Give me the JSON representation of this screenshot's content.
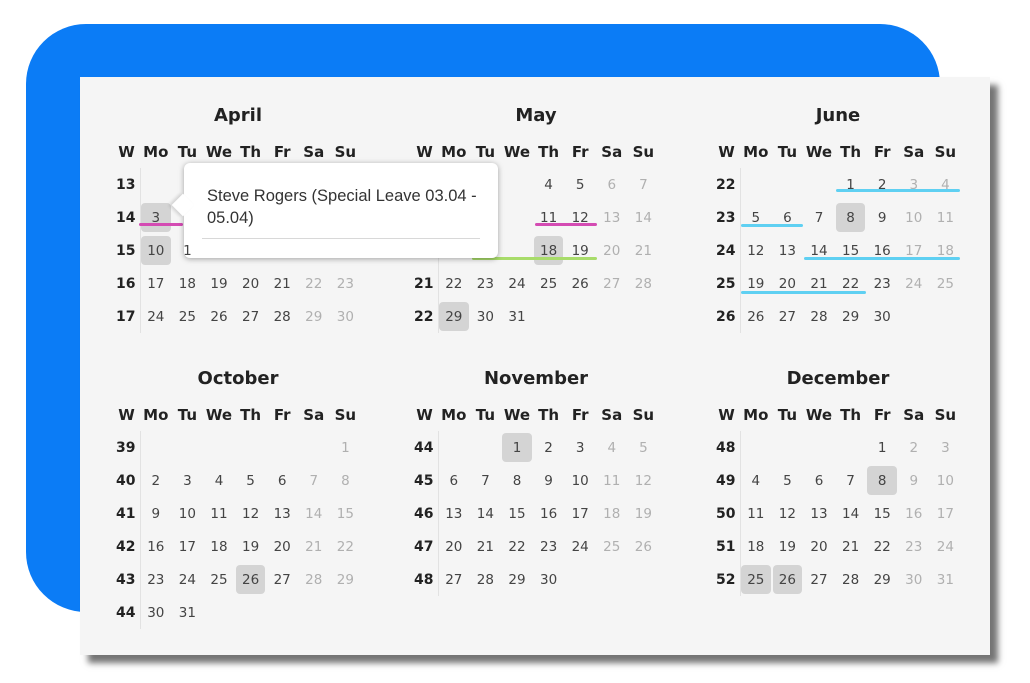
{
  "header_labels": [
    "W",
    "Mo",
    "Tu",
    "We",
    "Th",
    "Fr",
    "Sa",
    "Su"
  ],
  "tooltip": {
    "text": "Steve Rogers (Special Leave 03.04 - 05.04)"
  },
  "colors": {
    "accent_blue": "#0b7cf6",
    "bar_pink": "#d44bb3",
    "bar_green": "#a8dc6a",
    "bar_cyan": "#5fd0f2",
    "highlight": "#d4d4d4"
  },
  "months": [
    {
      "name": "April",
      "rows": [
        {
          "week": "13",
          "days": [
            "",
            "",
            "",
            "",
            "",
            "",
            ""
          ]
        },
        {
          "week": "14",
          "days": [
            "3",
            "",
            "",
            "",
            "",
            "",
            ""
          ]
        },
        {
          "week": "15",
          "days": [
            "10",
            "1",
            "",
            "",
            "",
            "",
            ""
          ]
        },
        {
          "week": "16",
          "days": [
            "17",
            "18",
            "19",
            "20",
            "21",
            "22",
            "23"
          ]
        },
        {
          "week": "17",
          "days": [
            "24",
            "25",
            "26",
            "27",
            "28",
            "29",
            "30"
          ]
        }
      ],
      "highlights": [
        "3",
        "10"
      ]
    },
    {
      "name": "May",
      "rows": [
        {
          "week": "",
          "days": [
            "",
            "",
            "",
            "4",
            "5",
            "6",
            "7"
          ]
        },
        {
          "week": "",
          "days": [
            "",
            "",
            "",
            "11",
            "12",
            "13",
            "14"
          ]
        },
        {
          "week": "",
          "days": [
            "",
            "",
            "",
            "18",
            "19",
            "20",
            "21"
          ]
        },
        {
          "week": "21",
          "days": [
            "22",
            "23",
            "24",
            "25",
            "26",
            "27",
            "28"
          ]
        },
        {
          "week": "22",
          "days": [
            "29",
            "30",
            "31",
            "",
            "",
            "",
            ""
          ]
        }
      ],
      "highlights": [
        "18",
        "29"
      ]
    },
    {
      "name": "June",
      "rows": [
        {
          "week": "22",
          "days": [
            "",
            "",
            "",
            "1",
            "2",
            "3",
            "4"
          ]
        },
        {
          "week": "23",
          "days": [
            "5",
            "6",
            "7",
            "8",
            "9",
            "10",
            "11"
          ]
        },
        {
          "week": "24",
          "days": [
            "12",
            "13",
            "14",
            "15",
            "16",
            "17",
            "18"
          ]
        },
        {
          "week": "25",
          "days": [
            "19",
            "20",
            "21",
            "22",
            "23",
            "24",
            "25"
          ]
        },
        {
          "week": "26",
          "days": [
            "26",
            "27",
            "28",
            "29",
            "30",
            "",
            ""
          ]
        }
      ],
      "highlights": [
        "8"
      ]
    },
    {
      "name": "October",
      "rows": [
        {
          "week": "39",
          "days": [
            "",
            "",
            "",
            "",
            "",
            "",
            "1"
          ]
        },
        {
          "week": "40",
          "days": [
            "2",
            "3",
            "4",
            "5",
            "6",
            "7",
            "8"
          ]
        },
        {
          "week": "41",
          "days": [
            "9",
            "10",
            "11",
            "12",
            "13",
            "14",
            "15"
          ]
        },
        {
          "week": "42",
          "days": [
            "16",
            "17",
            "18",
            "19",
            "20",
            "21",
            "22"
          ]
        },
        {
          "week": "43",
          "days": [
            "23",
            "24",
            "25",
            "26",
            "27",
            "28",
            "29"
          ]
        },
        {
          "week": "44",
          "days": [
            "30",
            "31",
            "",
            "",
            "",
            "",
            ""
          ]
        }
      ],
      "highlights": [
        "26"
      ]
    },
    {
      "name": "November",
      "rows": [
        {
          "week": "44",
          "days": [
            "",
            "",
            "1",
            "2",
            "3",
            "4",
            "5"
          ]
        },
        {
          "week": "45",
          "days": [
            "6",
            "7",
            "8",
            "9",
            "10",
            "11",
            "12"
          ]
        },
        {
          "week": "46",
          "days": [
            "13",
            "14",
            "15",
            "16",
            "17",
            "18",
            "19"
          ]
        },
        {
          "week": "47",
          "days": [
            "20",
            "21",
            "22",
            "23",
            "24",
            "25",
            "26"
          ]
        },
        {
          "week": "48",
          "days": [
            "27",
            "28",
            "29",
            "30",
            "",
            "",
            ""
          ]
        }
      ],
      "highlights": [
        "1"
      ]
    },
    {
      "name": "December",
      "rows": [
        {
          "week": "48",
          "days": [
            "",
            "",
            "",
            "",
            "1",
            "2",
            "3"
          ]
        },
        {
          "week": "49",
          "days": [
            "4",
            "5",
            "6",
            "7",
            "8",
            "9",
            "10"
          ]
        },
        {
          "week": "50",
          "days": [
            "11",
            "12",
            "13",
            "14",
            "15",
            "16",
            "17"
          ]
        },
        {
          "week": "51",
          "days": [
            "18",
            "19",
            "20",
            "21",
            "22",
            "23",
            "24"
          ]
        },
        {
          "week": "52",
          "days": [
            "25",
            "26",
            "27",
            "28",
            "29",
            "30",
            "31"
          ]
        }
      ],
      "highlights": [
        "8",
        "25",
        "26"
      ]
    }
  ]
}
